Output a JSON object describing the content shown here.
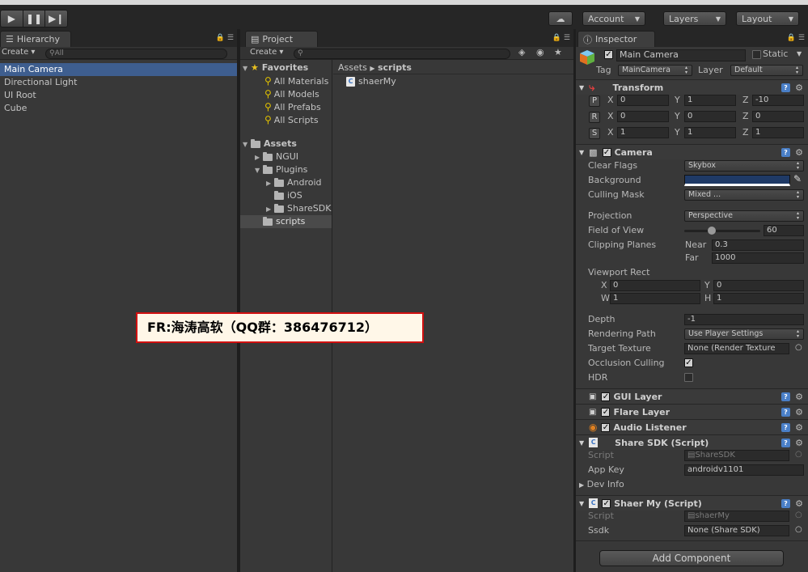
{
  "toolbar": {
    "play_icon": "play-icon",
    "pause_icon": "pause-icon",
    "step_icon": "step-icon",
    "cloud_icon": "cloud-icon",
    "account_label": "Account",
    "layers_label": "Layers",
    "layout_label": "Layout"
  },
  "hierarchy": {
    "tab_label": "Hierarchy",
    "create_label": "Create",
    "search_placeholder": "All",
    "items": [
      "Main Camera",
      "Directional Light",
      "UI Root",
      "Cube"
    ],
    "selected_index": 0
  },
  "project": {
    "tab_label": "Project",
    "create_label": "Create",
    "favorites_label": "Favorites",
    "favorites": [
      "All Materials",
      "All Models",
      "All Prefabs",
      "All Scripts"
    ],
    "assets_label": "Assets",
    "tree": {
      "ngui": "NGUI",
      "plugins": "Plugins",
      "android": "Android",
      "ios": "iOS",
      "sharesdk": "ShareSDK",
      "scripts": "scripts"
    },
    "breadcrumb_root": "Assets",
    "breadcrumb_current": "scripts",
    "files": [
      "shaerMy"
    ]
  },
  "inspector": {
    "tab_label": "Inspector",
    "object_name": "Main Camera",
    "static_label": "Static",
    "tag_label": "Tag",
    "tag_value": "MainCamera",
    "layer_label": "Layer",
    "layer_value": "Default",
    "transform": {
      "title": "Transform",
      "p": "P",
      "r": "R",
      "s": "S",
      "x": "X",
      "y": "Y",
      "z": "Z",
      "position": [
        "0",
        "1",
        "-10"
      ],
      "rotation": [
        "0",
        "0",
        "0"
      ],
      "scale": [
        "1",
        "1",
        "1"
      ]
    },
    "camera": {
      "title": "Camera",
      "clear_flags_label": "Clear Flags",
      "clear_flags": "Skybox",
      "background_label": "Background",
      "background_color": "#1f3a66",
      "culling_mask_label": "Culling Mask",
      "culling_mask": "Mixed ...",
      "projection_label": "Projection",
      "projection": "Perspective",
      "fov_label": "Field of View",
      "fov": "60",
      "fov_fraction": 0.35,
      "clipping_label": "Clipping Planes",
      "near_label": "Near",
      "near": "0.3",
      "far_label": "Far",
      "far": "1000",
      "viewport_label": "Viewport Rect",
      "vx_label": "X",
      "vx": "0",
      "vy_label": "Y",
      "vy": "0",
      "vw_label": "W",
      "vw": "1",
      "vh_label": "H",
      "vh": "1",
      "depth_label": "Depth",
      "depth": "-1",
      "rendering_path_label": "Rendering Path",
      "rendering_path": "Use Player Settings",
      "target_texture_label": "Target Texture",
      "target_texture": "None (Render Texture",
      "occlusion_label": "Occlusion Culling",
      "occlusion": true,
      "hdr_label": "HDR",
      "hdr": false
    },
    "gui_layer": "GUI Layer",
    "flare_layer": "Flare Layer",
    "audio_listener": "Audio Listener",
    "share_sdk": {
      "title": "Share SDK (Script)",
      "script_label": "Script",
      "script_value": "ShareSDK",
      "app_key_label": "App Key",
      "app_key": "androidv1101",
      "dev_info_label": "Dev Info"
    },
    "shaer_my": {
      "title": "Shaer My (Script)",
      "script_label": "Script",
      "script_value": "shaerMy",
      "ssdk_label": "Ssdk",
      "ssdk_value": "None (Share SDK)"
    },
    "add_component_label": "Add Component"
  },
  "watermark": {
    "text": "FR:海涛高软（QQ群：386476712）"
  },
  "colors": {
    "selection": "#3e5e8f",
    "watermark_border": "#d01010"
  }
}
